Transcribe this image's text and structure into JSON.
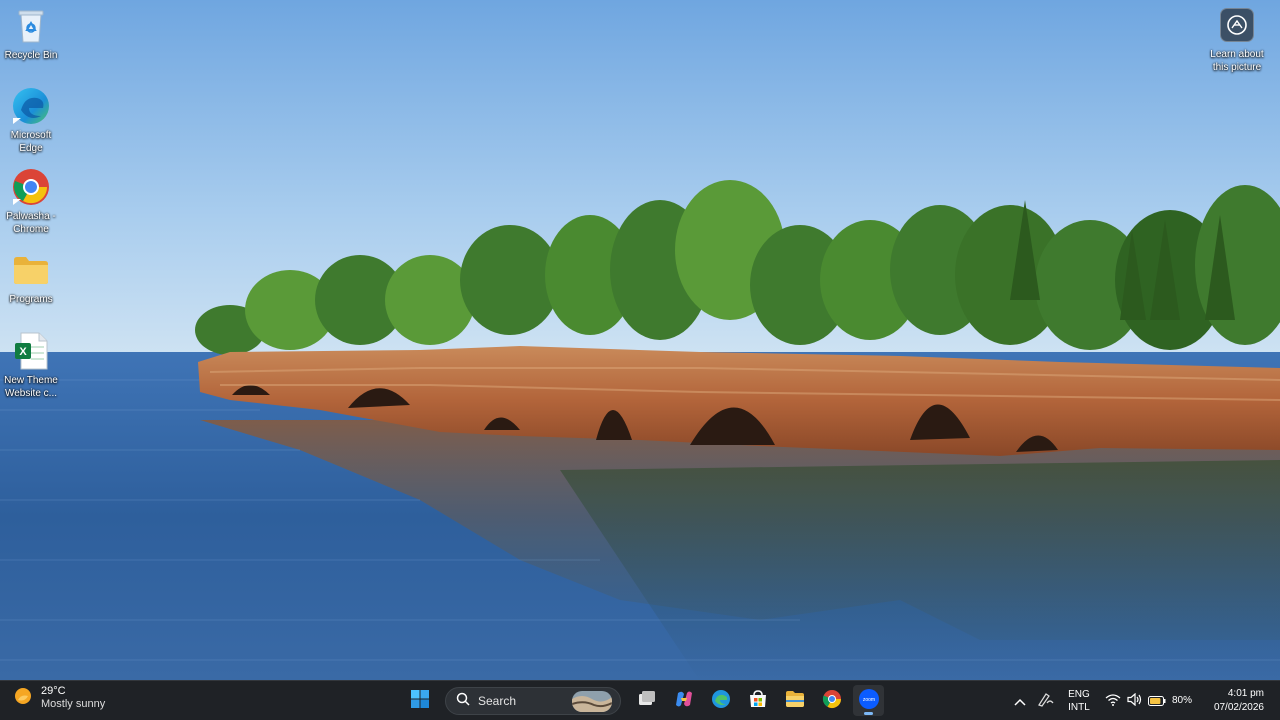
{
  "desktop": {
    "icons": [
      {
        "label": "Recycle Bin",
        "icon": "recycle-bin-icon"
      },
      {
        "label": "Microsoft\nEdge",
        "icon": "edge-icon"
      },
      {
        "label": "Palwasha -\nChrome",
        "icon": "chrome-icon"
      },
      {
        "label": "Programs",
        "icon": "folder-icon"
      },
      {
        "label": "New Theme\nWebsite c...",
        "icon": "excel-icon"
      }
    ],
    "learn_about": {
      "label": "Learn about\nthis picture",
      "icon": "camera-icon"
    }
  },
  "taskbar": {
    "weather": {
      "temp": "29°C",
      "condition": "Mostly sunny",
      "icon": "sun-icon"
    },
    "start_icon": "windows-start-icon",
    "search": {
      "label": "Search",
      "icon": "search-icon"
    },
    "pinned": [
      {
        "name": "task-view",
        "icon": "task-view-icon"
      },
      {
        "name": "copilot",
        "icon": "copilot-icon"
      },
      {
        "name": "edge",
        "icon": "edge-icon"
      },
      {
        "name": "microsoft-store",
        "icon": "store-icon"
      },
      {
        "name": "file-explorer",
        "icon": "folder-icon"
      },
      {
        "name": "chrome",
        "icon": "chrome-icon"
      },
      {
        "name": "zoom",
        "icon": "zoom-icon",
        "active": true
      }
    ],
    "tray": {
      "overflow_icon": "chevron-up-icon",
      "pen_icon": "pen-icon",
      "language_line1": "ENG",
      "language_line2": "INTL",
      "wifi_icon": "wifi-icon",
      "volume_icon": "volume-icon",
      "battery_icon": "battery-icon",
      "battery_pct": "80%",
      "time": "4:01 pm",
      "date": "07/02/2026"
    }
  },
  "colors": {
    "taskbar_bg": "#1f2226",
    "accent": "#7db8f5"
  }
}
